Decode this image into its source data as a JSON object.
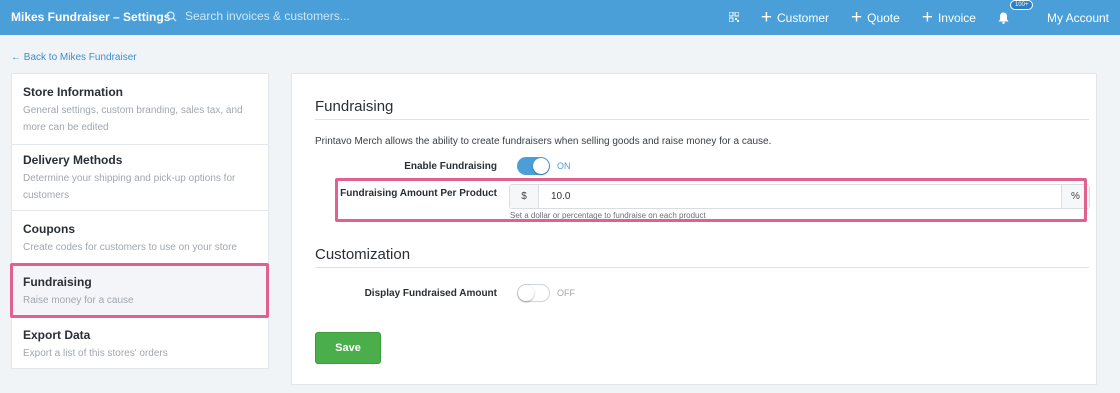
{
  "header": {
    "title": "Mikes Fundraiser – Settings",
    "search_placeholder": "Search invoices & customers...",
    "customer_label": "Customer",
    "quote_label": "Quote",
    "invoice_label": "Invoice",
    "notification_badge": "100+",
    "account_label": "My Account"
  },
  "back_link": "← Back to Mikes Fundraiser",
  "sidebar": {
    "items": [
      {
        "title": "Store Information",
        "desc": "General settings, custom branding, sales tax, and more can be edited"
      },
      {
        "title": "Delivery Methods",
        "desc": "Determine your shipping and pick-up options for customers"
      },
      {
        "title": "Coupons",
        "desc": "Create codes for customers to use on your store"
      },
      {
        "title": "Fundraising",
        "desc": "Raise money for a cause"
      },
      {
        "title": "Export Data",
        "desc": "Export a list of this stores' orders"
      }
    ]
  },
  "main": {
    "fundraising_title": "Fundraising",
    "intro": "Printavo Merch allows the ability to create fundraisers when selling goods and raise money for a cause.",
    "enable_label": "Enable Fundraising",
    "enable_state": "ON",
    "amount_label": "Fundraising Amount Per Product",
    "currency_symbol": "$",
    "amount_value": "10.0",
    "percent_symbol": "%",
    "amount_help": "Set a dollar or percentage to fundraise on each product",
    "customization_title": "Customization",
    "display_label": "Display Fundraised Amount",
    "display_state": "OFF",
    "save_label": "Save"
  },
  "colors": {
    "header_bg": "#4a9fd8",
    "toggle_on": "#4a9fd8",
    "save_button": "#4aae4a",
    "highlight": "#e2608e"
  }
}
